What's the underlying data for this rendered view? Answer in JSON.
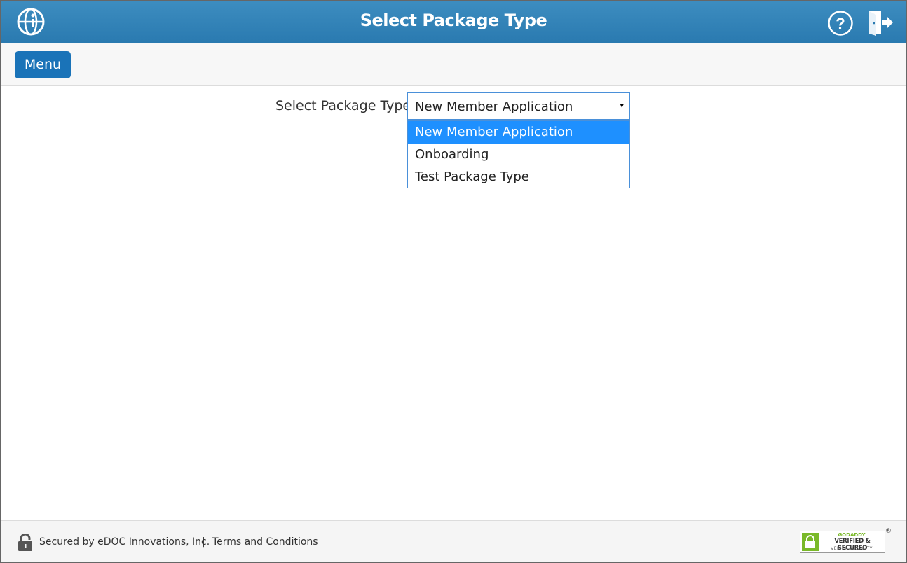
{
  "header": {
    "title": "Select Package Type",
    "logo_icon": "edoc-globe-logo",
    "help_icon": "help-circle-icon",
    "logout_icon": "logout-door-icon",
    "colors": {
      "bar": "#2a7ab0",
      "text": "#ffffff"
    }
  },
  "toolbar": {
    "menu_label": "Menu",
    "menu_color": "#1a73b8"
  },
  "form": {
    "label": "Select Package Type:",
    "selected_value": "New Member Application",
    "arrow": "▾",
    "options": [
      {
        "label": "New Member Application",
        "highlighted": true
      },
      {
        "label": "Onboarding",
        "highlighted": false
      },
      {
        "label": "Test Package Type",
        "highlighted": false
      }
    ],
    "highlight_color": "#1e90ff"
  },
  "footer": {
    "secured_text": "Secured by eDOC Innovations, Inc.",
    "separator": "|",
    "terms_label": "Terms and Conditions",
    "lock_icon": "padlock-icon",
    "seal": {
      "brand": "GODADDY",
      "main": "VERIFIED & SECURED",
      "sub": "VERIFY SECURITY",
      "reg": "®"
    }
  }
}
